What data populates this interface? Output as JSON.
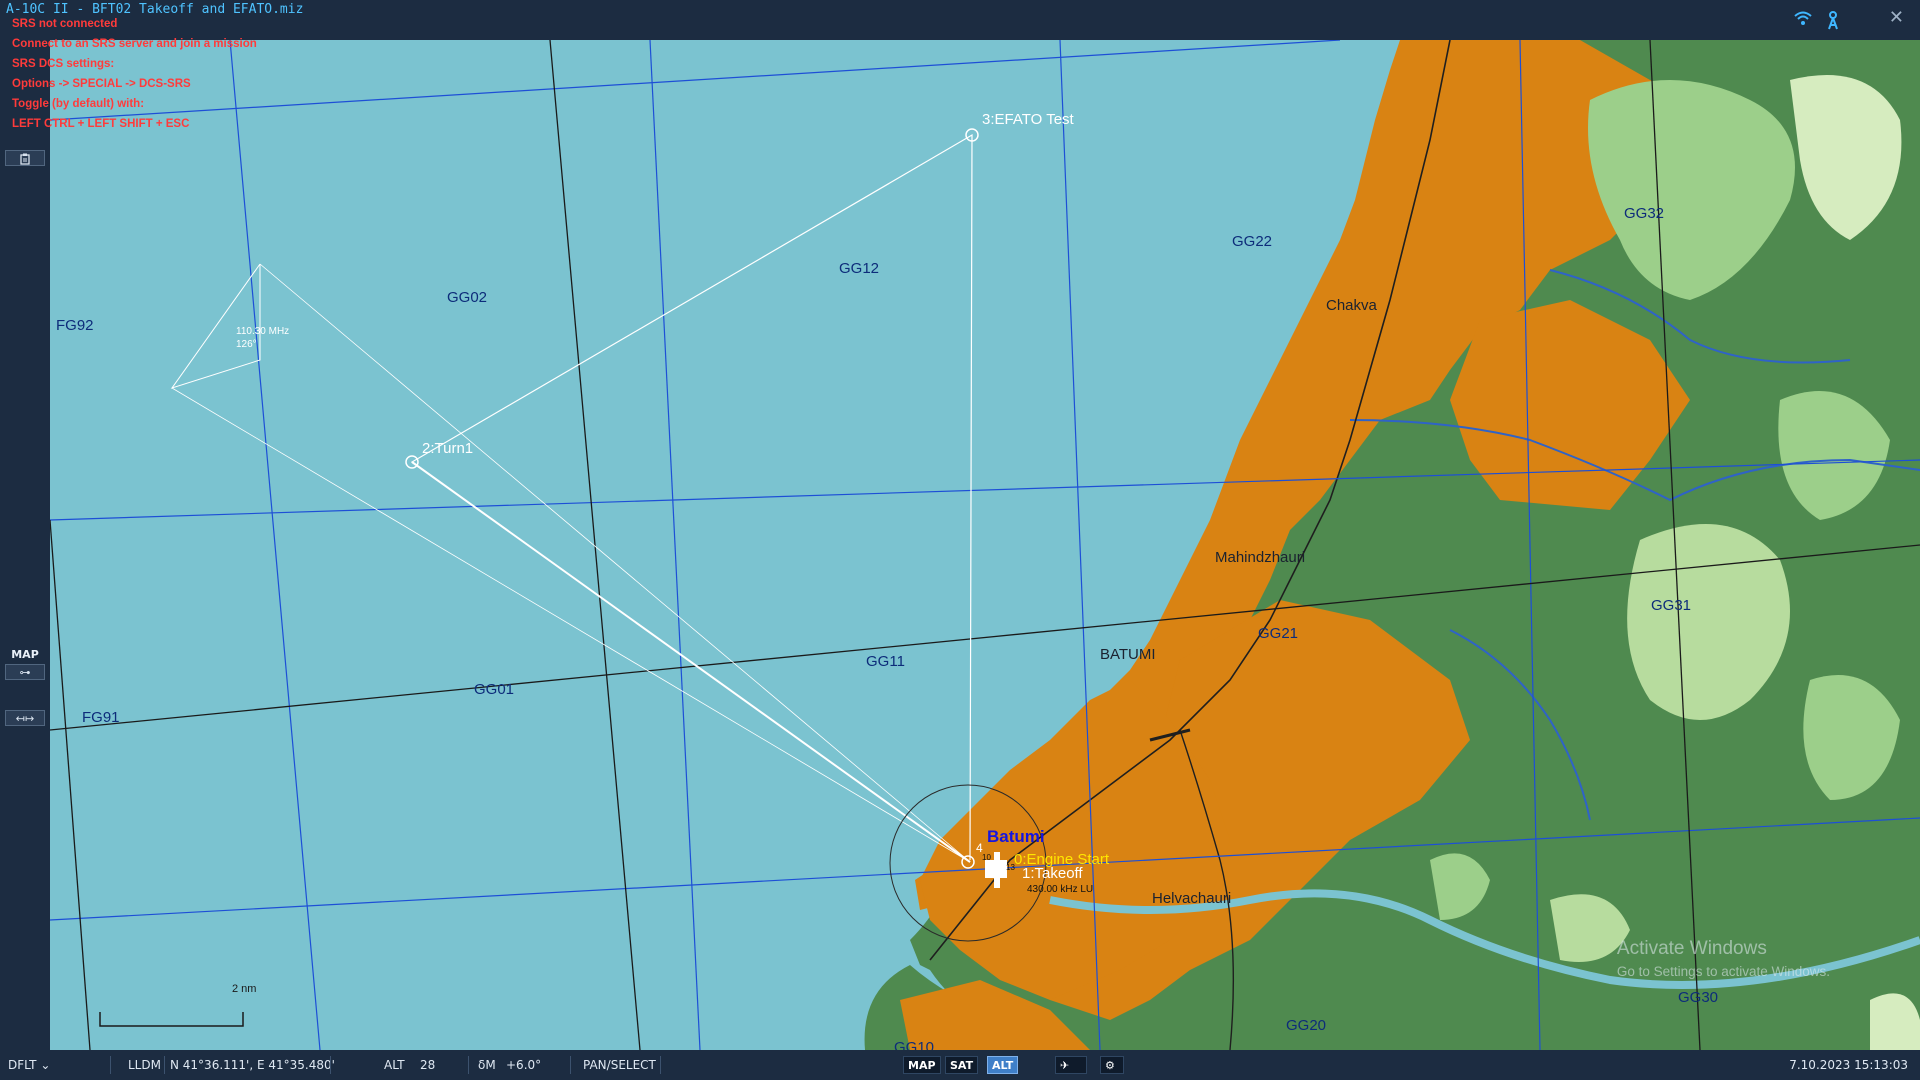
{
  "window": {
    "title": "A-10C II - BFT02 Takeoff and EFATO.miz",
    "close_glyph": "✕"
  },
  "srs_notice": [
    "SRS not connected",
    "Connect to an SRS server and join a mission",
    "SRS DCS settings:",
    "Options -> SPECIAL -> DCS-SRS",
    "Toggle (by default) with:",
    "LEFT CTRL + LEFT SHIFT + ESC"
  ],
  "toolbar": {
    "top_icon": "clipboard-icon",
    "map_label": "MAP",
    "map_key_glyph": "⊶",
    "ruler_glyph": "↤↦"
  },
  "map": {
    "grid_labels": [
      "FG92",
      "GG02",
      "GG12",
      "GG22",
      "GG32",
      "FG91",
      "GG01",
      "GG11",
      "GG21",
      "GG31",
      "GG20",
      "GG30",
      "GG10"
    ],
    "places": [
      "Chakva",
      "Mahindzhauri",
      "BATUMI",
      "Helvachauri"
    ],
    "airfield": {
      "name": "Batumi",
      "beacon": "430.00 kHz LU",
      "elevation": "10",
      "runway_label": "13"
    },
    "waypoints": [
      "0:Engine Start",
      "1:Takeoff",
      "2:Turn1",
      "3:EFATO Test",
      "4"
    ],
    "nav_aid": {
      "freq": "110.30 MHz",
      "bearing": "126°"
    },
    "scale_label": "2 nm",
    "colors": {
      "sea": "#7bc3d0",
      "urban": "#d98313",
      "forest": "#4f8a4f",
      "grid": "#1d4fd6"
    }
  },
  "watermark": {
    "line1": "Activate Windows",
    "line2": "Go to Settings to activate Windows."
  },
  "statusbar": {
    "profile": "DFLT",
    "coord_mode": "LLDM",
    "coords": "N 41°36.111', E 41°35.480'",
    "alt_label": "ALT",
    "alt_value": "28",
    "dm_label": "δM",
    "dm_value": "+6.0°",
    "mode": "PAN/SELECT",
    "btn_map": "MAP",
    "btn_sat": "SAT",
    "btn_alt": "ALT",
    "datetime": "7.10.2023 15:13:03"
  }
}
